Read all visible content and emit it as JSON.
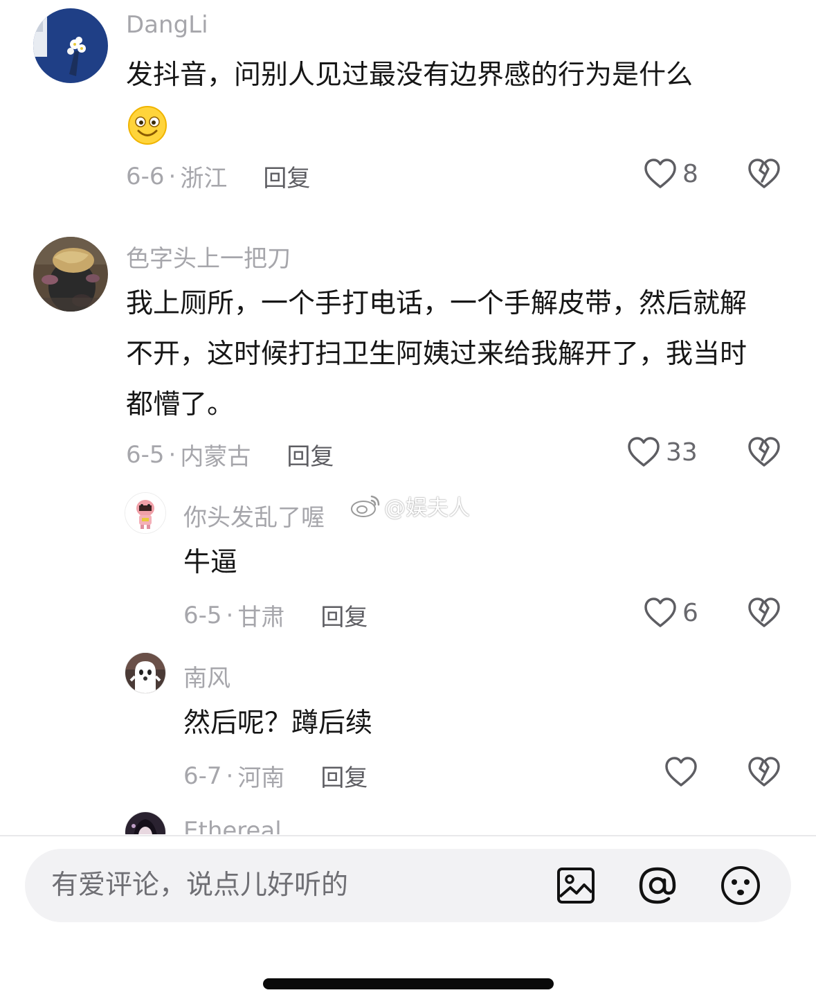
{
  "comments": [
    {
      "username": "DangLi",
      "text": "发抖音，问别人见过最没有边界感的行为是什么",
      "emoji": "smiley-emoji",
      "date": "6-6",
      "sep": "·",
      "location": "浙江",
      "reply": "回复",
      "likes": "8"
    },
    {
      "username": "色字头上一把刀",
      "text": "我上厕所，一个手打电话，一个手解皮带，然后就解不开，这时候打扫卫生阿姨过来给我解开了，我当时都懵了。",
      "date": "6-5",
      "sep": "·",
      "location": "内蒙古",
      "reply": "回复",
      "likes": "33"
    }
  ],
  "replies": [
    {
      "username": "你头发乱了喔",
      "text": "牛逼",
      "date": "6-5",
      "sep": "·",
      "location": "甘肃",
      "reply": "回复",
      "likes": "6"
    },
    {
      "username": "南风",
      "text": "然后呢？蹲后续",
      "date": "6-7",
      "sep": "·",
      "location": "河南",
      "reply": "回复",
      "likes": ""
    },
    {
      "username": "Ethereal"
    }
  ],
  "watermark": "@娱夫人",
  "input": {
    "placeholder": "有爱评论，说点儿好听的",
    "icons": [
      "image-icon",
      "at-icon",
      "emoji-icon"
    ]
  },
  "colors": {
    "text": "#161616",
    "meta": "#a6a6ab",
    "reply": "#5d5d62",
    "input_bg": "#f2f2f4"
  }
}
